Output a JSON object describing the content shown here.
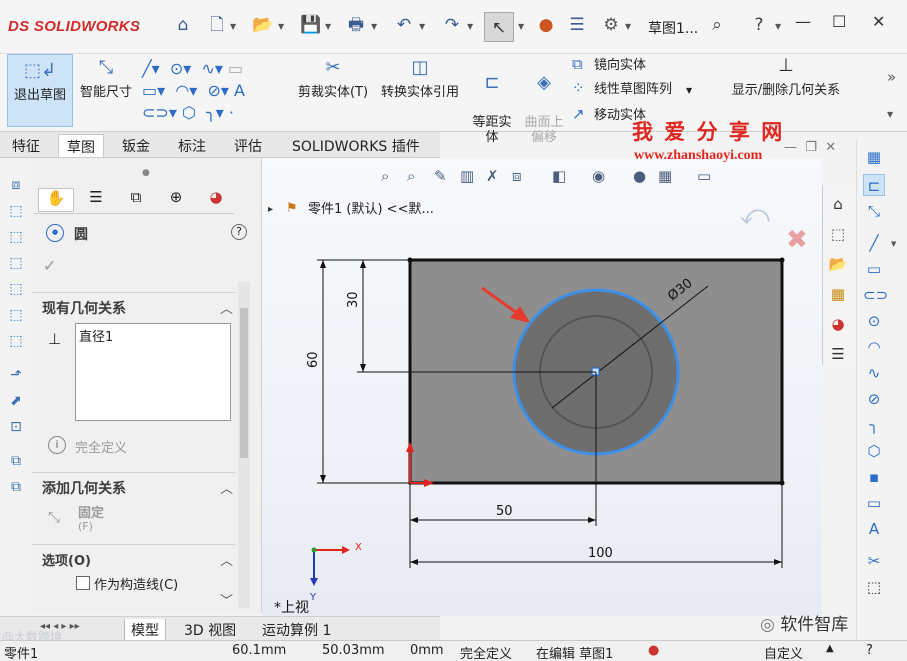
{
  "app": {
    "brand": "SOLIDWORKS",
    "document_title": "草图1...",
    "brand_prefix": "DS"
  },
  "titlebar": {
    "icons": [
      "home-icon",
      "new-icon",
      "open-icon",
      "save-icon",
      "print-icon",
      "undo-icon",
      "redo-icon",
      "select-icon",
      "traffic-light-icon",
      "file-properties-icon",
      "options-icon"
    ],
    "search_icon": "search-icon",
    "help_icon": "help-icon"
  },
  "command_manager": {
    "exit_sketch": "退出草图",
    "smart_dimension": "智能尺寸",
    "trim_entities": "剪裁实体(T)",
    "convert_entities": "转换实体引用",
    "offset_entities": "等距实\n体",
    "offset_on_surface": "曲面上\n偏移",
    "mirror_entities": "镜向实体",
    "linear_pattern": "线性草图阵列",
    "move_entities": "移动实体",
    "display_relations": "显示/删除几何关系"
  },
  "watermark": {
    "title": "我 爱 分 享 网",
    "url": "www.zhanshaoyi.com",
    "bottom_right": "软件智库",
    "bottom_left": "@大数跨境"
  },
  "tabs": [
    "特征",
    "草图",
    "钣金",
    "标注",
    "评估",
    "SOLIDWORKS 插件"
  ],
  "active_tab_index": 1,
  "property_manager": {
    "title": "圆",
    "existing_relations_header": "现有几何关系",
    "relations": [
      "直径1"
    ],
    "status": "完全定义",
    "add_relations_header": "添加几何关系",
    "fix_label": "固定",
    "fix_shortcut": "(F)",
    "options_header": "选项(O)",
    "construction_label": "作为构造线(C)",
    "construction_checked": false
  },
  "tree": {
    "item": "零件1 (默认) <<默..."
  },
  "view": {
    "orientation": "*上视"
  },
  "sketch": {
    "dims": {
      "diameter": "Ø30",
      "height_30": "30",
      "height_60": "60",
      "width_50": "50",
      "width_100": "100"
    },
    "axis_x": "X",
    "axis_y": "Y"
  },
  "bottom_tabs": [
    "模型",
    "3D 视图",
    "运动算例 1"
  ],
  "active_bottom_tab": 0,
  "status_bar": {
    "part": "零件1",
    "x": "60.1mm",
    "y": "50.03mm",
    "z": "0mm",
    "definition": "完全定义",
    "editing": "在编辑 草图1",
    "units": "自定义"
  },
  "colors": {
    "accent": "#2c6cc9",
    "circle_highlight": "#3d8fe8",
    "rect_fill": "#8c8c8c",
    "arrow": "#e63a2e",
    "watermark_red": "#e0261f"
  }
}
